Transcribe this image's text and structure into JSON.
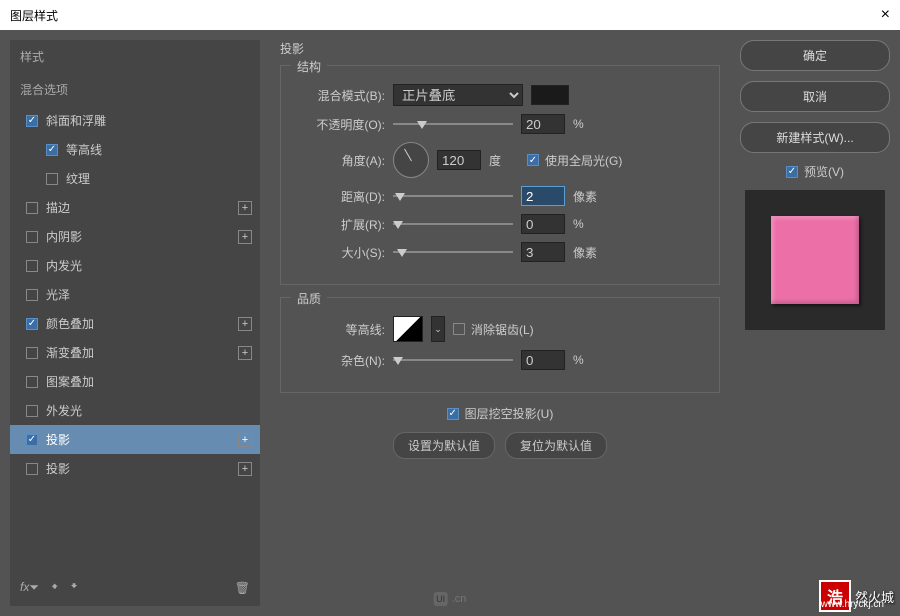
{
  "window": {
    "title": "图层样式",
    "close": "×"
  },
  "sidebar": {
    "styles_header": "样式",
    "blend_header": "混合选项",
    "items": [
      {
        "label": "斜面和浮雕",
        "checked": true,
        "plus": false,
        "indent": 1
      },
      {
        "label": "等高线",
        "checked": true,
        "plus": false,
        "indent": 2
      },
      {
        "label": "纹理",
        "checked": false,
        "plus": false,
        "indent": 2
      },
      {
        "label": "描边",
        "checked": false,
        "plus": true,
        "indent": 1
      },
      {
        "label": "内阴影",
        "checked": false,
        "plus": true,
        "indent": 1
      },
      {
        "label": "内发光",
        "checked": false,
        "plus": false,
        "indent": 1
      },
      {
        "label": "光泽",
        "checked": false,
        "plus": false,
        "indent": 1
      },
      {
        "label": "颜色叠加",
        "checked": true,
        "plus": true,
        "indent": 1
      },
      {
        "label": "渐变叠加",
        "checked": false,
        "plus": true,
        "indent": 1
      },
      {
        "label": "图案叠加",
        "checked": false,
        "plus": false,
        "indent": 1
      },
      {
        "label": "外发光",
        "checked": false,
        "plus": false,
        "indent": 1
      },
      {
        "label": "投影",
        "checked": true,
        "plus": true,
        "indent": 1,
        "selected": true
      },
      {
        "label": "投影",
        "checked": false,
        "plus": true,
        "indent": 1
      }
    ],
    "fx_label": "fx"
  },
  "center": {
    "title": "投影",
    "structure": {
      "group_title": "结构",
      "blend_mode_label": "混合模式(B):",
      "blend_mode_value": "正片叠底",
      "opacity_label": "不透明度(O):",
      "opacity_value": "20",
      "opacity_unit": "%",
      "angle_label": "角度(A):",
      "angle_value": "120",
      "angle_unit": "度",
      "global_light_label": "使用全局光(G)",
      "distance_label": "距离(D):",
      "distance_value": "2",
      "distance_unit": "像素",
      "spread_label": "扩展(R):",
      "spread_value": "0",
      "spread_unit": "%",
      "size_label": "大小(S):",
      "size_value": "3",
      "size_unit": "像素"
    },
    "quality": {
      "group_title": "品质",
      "contour_label": "等高线:",
      "antialias_label": "消除锯齿(L)",
      "noise_label": "杂色(N):",
      "noise_value": "0",
      "noise_unit": "%"
    },
    "knockout_label": "图层挖空投影(U)",
    "make_default": "设置为默认值",
    "reset_default": "复位为默认值"
  },
  "right": {
    "ok": "确定",
    "cancel": "取消",
    "new_style": "新建样式(W)...",
    "preview_label": "预览(V)"
  },
  "footer": {
    "ui_label": ".cn"
  },
  "watermark": {
    "badge": "浩",
    "text": "然火城",
    "url": "www.hryckj.cn"
  }
}
